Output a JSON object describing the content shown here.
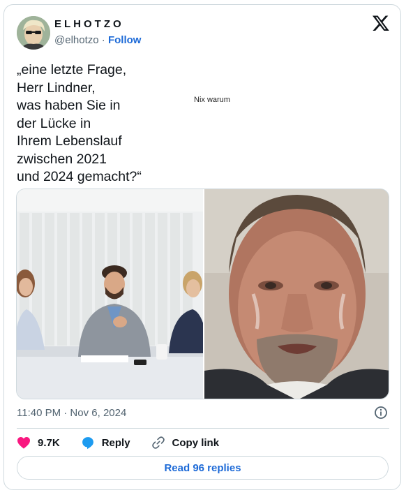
{
  "author": {
    "display_name": "ELHOTZO",
    "handle": "@elhotzo",
    "separator": "·",
    "follow_label": "Follow"
  },
  "tweet": {
    "text": "„eine letzte Frage,\nHerr Lindner,\nwas haben Sie in\nder Lücke in\nIhrem Lebenslauf\nzwischen 2021\nund 2024 gemacht?“",
    "side_text": "Nix warum",
    "timestamp": "11:40 PM · Nov 6, 2024"
  },
  "actions": {
    "likes": "9.7K",
    "reply_label": "Reply",
    "copy_link_label": "Copy link"
  },
  "footer": {
    "read_replies_label": "Read 96 replies"
  },
  "colors": {
    "like": "#f91880",
    "reply": "#1d9bf0",
    "link": "#1d6ad7",
    "muted": "#536471"
  },
  "icons": [
    "x-logo-icon",
    "heart-icon",
    "reply-bubble-icon",
    "link-icon",
    "info-icon"
  ]
}
